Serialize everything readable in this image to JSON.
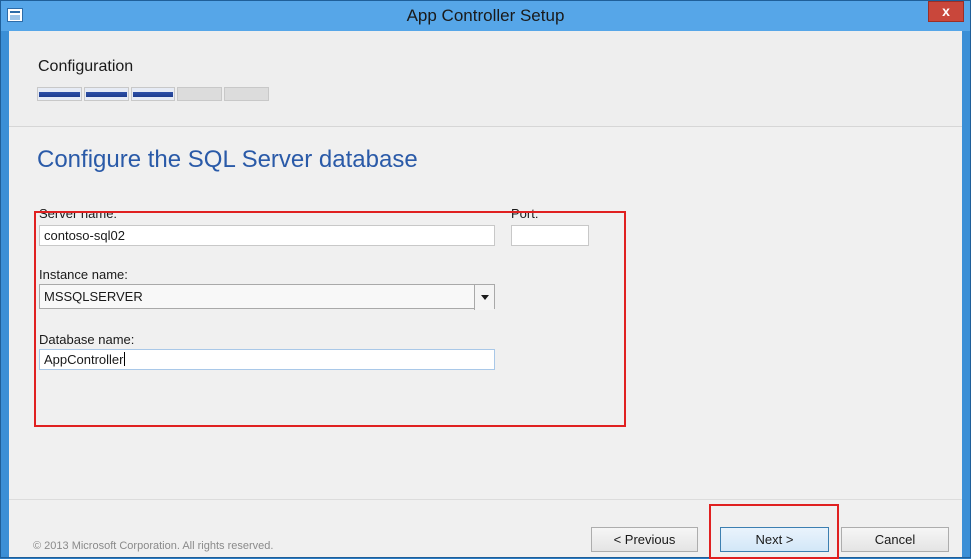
{
  "window": {
    "title": "App Controller Setup",
    "close_label": "x"
  },
  "header": {
    "stage": "Configuration",
    "progress": {
      "completed_steps": 3,
      "total_steps": 5
    }
  },
  "main": {
    "heading": "Configure the SQL Server database",
    "server_name": {
      "label": "Server name:",
      "value": "contoso-sql02"
    },
    "port": {
      "label": "Port:",
      "value": ""
    },
    "instance_name": {
      "label": "Instance name:",
      "value": "MSSQLSERVER"
    },
    "database_name": {
      "label": "Database name:",
      "value": "AppController"
    }
  },
  "footer": {
    "copyright": "© 2013 Microsoft Corporation. All rights reserved.",
    "previous_label": "< Previous",
    "next_label": "Next >",
    "cancel_label": "Cancel"
  },
  "colors": {
    "accent": "#2a5aa8",
    "annotation": "#e02020",
    "titlebar": "#56a6e8"
  },
  "icons": [
    "app-icon",
    "close-icon",
    "chevron-down-icon"
  ]
}
